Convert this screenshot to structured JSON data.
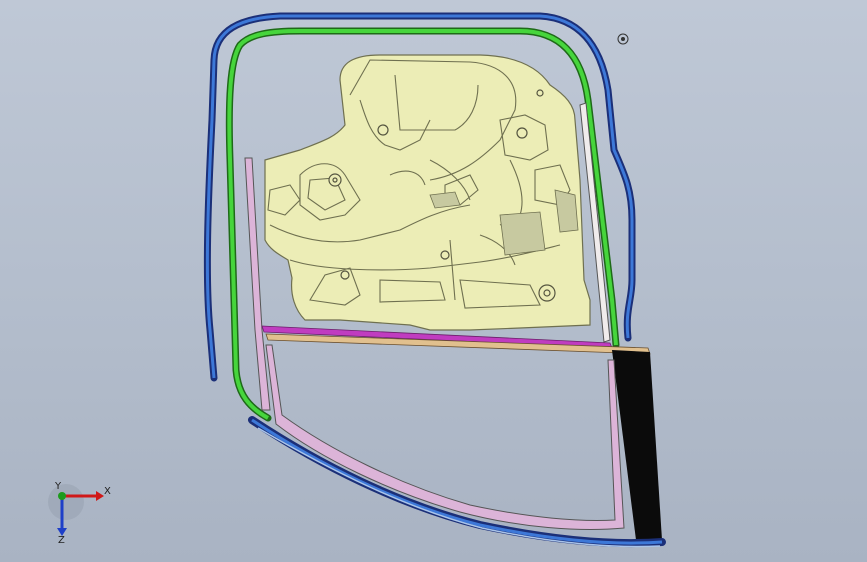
{
  "viewport": {
    "background": "#b8c2d1"
  },
  "colors": {
    "trim_panel": "#ecedb6",
    "trim_panel_edge": "#6f7050",
    "seal_outer": "#2a5db0",
    "seal_outer_dark": "#1b2f78",
    "seal_green": "#46d53c",
    "frame_pink": "#dcb4d8",
    "beltline_magenta": "#c03cc0",
    "beltline_tan": "#e1c08e",
    "glass_black": "#0b0b0b",
    "triad_x": "#d01818",
    "triad_y": "#1d9b1d",
    "triad_z": "#1e3fc8"
  },
  "triad": {
    "x_label": "X",
    "y_label": "Y",
    "z_label": "Z"
  },
  "icons": {
    "target": "target-icon"
  }
}
